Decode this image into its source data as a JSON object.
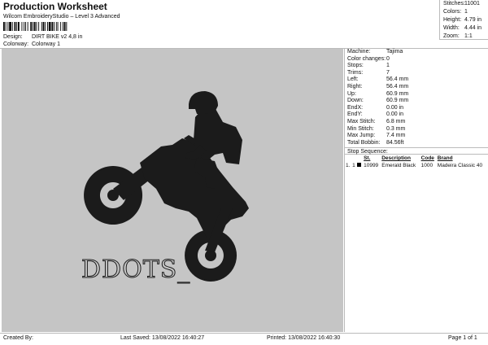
{
  "header": {
    "title": "Production Worksheet",
    "software": "Wilcom EmbroideryStudio – Level 3 Advanced",
    "design_label": "Design:",
    "design_value": "DIRT BIKE v2 4,8 in",
    "colorway_label": "Colorway:",
    "colorway_value": "Colorway 1"
  },
  "stats": [
    {
      "label": "Stitches:",
      "value": "11001"
    },
    {
      "label": "Colors:",
      "value": "1"
    },
    {
      "label": "Height:",
      "value": "4.79 in"
    },
    {
      "label": "Width:",
      "value": "4.44 in"
    },
    {
      "label": "Zoom:",
      "value": "1:1"
    }
  ],
  "design_text": "DDOTS_",
  "info": [
    {
      "label": "Machine:",
      "value": "Tajima"
    },
    {
      "label": "Color changes:",
      "value": "0"
    },
    {
      "label": "Stops:",
      "value": "1"
    },
    {
      "label": "Trims:",
      "value": "7"
    },
    {
      "label": "Left:",
      "value": "56.4 mm"
    },
    {
      "label": "Right:",
      "value": "56.4 mm"
    },
    {
      "label": "Up:",
      "value": "60.9 mm"
    },
    {
      "label": "Down:",
      "value": "60.9 mm"
    },
    {
      "label": "EndX:",
      "value": "0.00 in"
    },
    {
      "label": "EndY:",
      "value": "0.00 in"
    },
    {
      "label": "Max Stitch:",
      "value": "6.8 mm"
    },
    {
      "label": "Min Stitch:",
      "value": "0.3 mm"
    },
    {
      "label": "Max Jump:",
      "value": "7.4 mm"
    },
    {
      "label": "Total Bobbin:",
      "value": "84.56ft"
    }
  ],
  "stop_sequence": {
    "title": "Stop Sequence:",
    "columns": [
      "",
      "",
      "",
      "St.",
      "Description",
      "Code",
      "Brand"
    ],
    "rows": [
      {
        "num": "1.",
        "stop": "1",
        "color": "#000000",
        "stitches": "10999",
        "description": "Emerald Black",
        "code": "1000",
        "brand": "Madeira Classic 40"
      }
    ]
  },
  "footer": {
    "created_by": "Created By:",
    "last_saved": "Last Saved: 13/08/2022 16:40:27",
    "printed": "Printed: 13/08/2022 16:40:30",
    "page": "Page 1 of 1"
  },
  "colors": {
    "canvas": "#c5c5c5",
    "thread": "#1b1b1b"
  }
}
